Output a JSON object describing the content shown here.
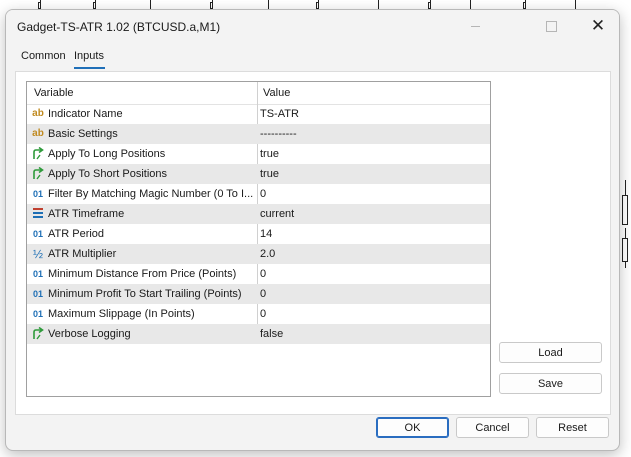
{
  "window": {
    "title": "Gadget-TS-ATR 1.02 (BTCUSD.a,M1)",
    "minimize_icon": "minimize-icon",
    "maximize_icon": "maximize-icon",
    "close_glyph": "✕"
  },
  "tabs": [
    {
      "label": "Common",
      "active": false
    },
    {
      "label": "Inputs",
      "active": true
    }
  ],
  "table": {
    "headers": {
      "variable": "Variable",
      "value": "Value"
    },
    "rows": [
      {
        "icon": "ab",
        "variable": "Indicator Name",
        "value": "TS-ATR"
      },
      {
        "icon": "ab",
        "variable": "Basic Settings",
        "value": "----------"
      },
      {
        "icon": "bool",
        "variable": "Apply To Long Positions",
        "value": "true"
      },
      {
        "icon": "bool",
        "variable": "Apply To Short Positions",
        "value": "true"
      },
      {
        "icon": "01",
        "variable": "Filter By Matching Magic Number (0 To I...",
        "value": "0"
      },
      {
        "icon": "timeframe",
        "variable": "ATR Timeframe",
        "value": "current"
      },
      {
        "icon": "01",
        "variable": "ATR Period",
        "value": "14"
      },
      {
        "icon": "half",
        "variable": "ATR Multiplier",
        "value": "2.0"
      },
      {
        "icon": "01",
        "variable": "Minimum Distance From Price (Points)",
        "value": "0"
      },
      {
        "icon": "01",
        "variable": "Minimum Profit To Start Trailing (Points)",
        "value": "0"
      },
      {
        "icon": "01",
        "variable": "Maximum Slippage (In Points)",
        "value": "0"
      },
      {
        "icon": "bool",
        "variable": "Verbose Logging",
        "value": "false"
      }
    ]
  },
  "icon_glyphs": {
    "ab": "ab",
    "01": "01",
    "half": "½"
  },
  "buttons": {
    "load": "Load",
    "save": "Save",
    "ok": "OK",
    "cancel": "Cancel",
    "reset": "Reset"
  },
  "colors": {
    "accent": "#1f6fb8",
    "string_icon": "#c08a20",
    "int_icon": "#1e6fb5",
    "bool_icon": "#2e9a3a",
    "alt_row": "#e8e8e8"
  }
}
